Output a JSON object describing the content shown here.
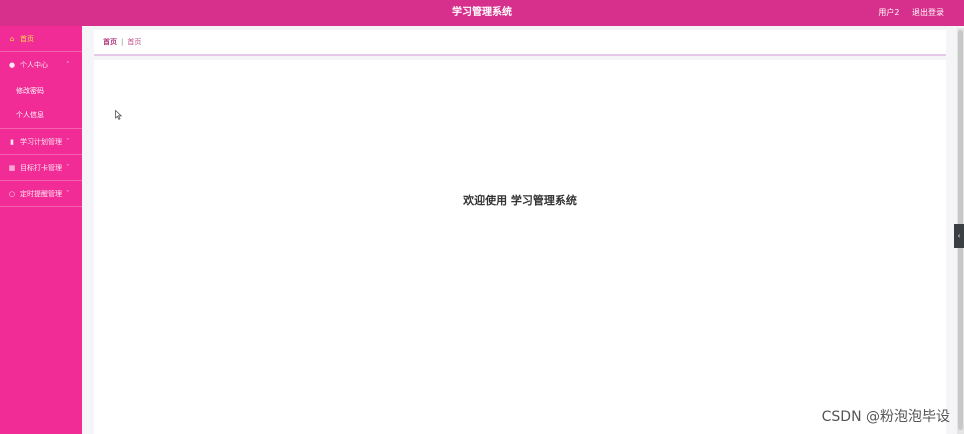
{
  "header": {
    "title": "学习管理系统",
    "user": "用户2",
    "logout": "退出登录",
    "bg_color": "#d62f8c"
  },
  "sidebar": {
    "bg_color": "#f22c96",
    "items": [
      {
        "label": "首页",
        "icon": "home-icon"
      },
      {
        "label": "个人中心",
        "icon": "user-icon"
      },
      {
        "label": "学习计划管理",
        "icon": "bar-chart-icon"
      },
      {
        "label": "目标打卡管理",
        "icon": "grid-chart-icon"
      },
      {
        "label": "定时提醒管理",
        "icon": "clock-icon"
      }
    ],
    "sub_items": [
      {
        "label": "修改密码"
      },
      {
        "label": "个人信息"
      }
    ]
  },
  "breadcrumb": {
    "first": "首页",
    "separator": "|",
    "current": "首页"
  },
  "main": {
    "welcome": "欢迎使用 学习管理系统"
  },
  "watermark": "CSDN @粉泡泡毕设"
}
